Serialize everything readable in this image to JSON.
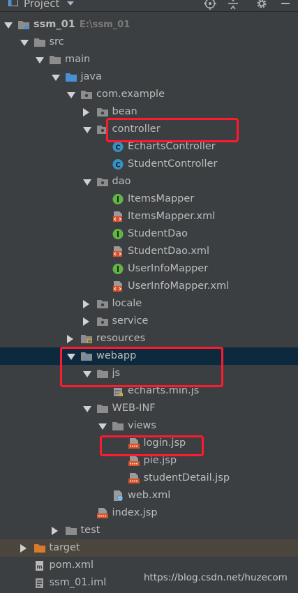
{
  "panel": {
    "title": "Project"
  },
  "tree": [
    {
      "name": "tree-item-ssm-01",
      "label": "ssm_01",
      "path": "E:\\ssm_01",
      "icon": "module-icon",
      "arrow": "down"
    },
    {
      "name": "tree-item-src",
      "label": "src",
      "icon": "folder-icon",
      "arrow": "down"
    },
    {
      "name": "tree-item-main",
      "label": "main",
      "icon": "folder-icon",
      "arrow": "down"
    },
    {
      "name": "tree-item-java",
      "label": "java",
      "icon": "source-folder-icon",
      "arrow": "down"
    },
    {
      "name": "tree-item-com-example",
      "label": "com.example",
      "icon": "package-icon",
      "arrow": "down"
    },
    {
      "name": "tree-item-bean",
      "label": "bean",
      "icon": "package-icon",
      "arrow": "right"
    },
    {
      "name": "tree-item-controller",
      "label": "controller",
      "icon": "package-icon",
      "arrow": "down"
    },
    {
      "name": "tree-item-echarts-controller",
      "label": "EchartsController",
      "icon": "class-icon",
      "arrow": ""
    },
    {
      "name": "tree-item-student-controller",
      "label": "StudentController",
      "icon": "class-icon",
      "arrow": ""
    },
    {
      "name": "tree-item-dao",
      "label": "dao",
      "icon": "package-icon",
      "arrow": "down"
    },
    {
      "name": "tree-item-items-mapper",
      "label": "ItemsMapper",
      "icon": "interface-icon",
      "arrow": ""
    },
    {
      "name": "tree-item-items-mapper-xml",
      "label": "ItemsMapper.xml",
      "icon": "xml-file-icon",
      "arrow": ""
    },
    {
      "name": "tree-item-student-dao",
      "label": "StudentDao",
      "icon": "interface-icon",
      "arrow": ""
    },
    {
      "name": "tree-item-student-dao-xml",
      "label": "StudentDao.xml",
      "icon": "xml-file-icon",
      "arrow": ""
    },
    {
      "name": "tree-item-user-info-mapper",
      "label": "UserInfoMapper",
      "icon": "interface-icon",
      "arrow": ""
    },
    {
      "name": "tree-item-user-info-mapper-xml",
      "label": "UserInfoMapper.xml",
      "icon": "xml-file-icon",
      "arrow": ""
    },
    {
      "name": "tree-item-locale",
      "label": "locale",
      "icon": "package-icon",
      "arrow": "right"
    },
    {
      "name": "tree-item-service",
      "label": "service",
      "icon": "package-icon",
      "arrow": "right"
    },
    {
      "name": "tree-item-resources",
      "label": "resources",
      "icon": "resources-folder-icon",
      "arrow": "right"
    },
    {
      "name": "tree-item-webapp",
      "label": "webapp",
      "icon": "web-folder-icon",
      "arrow": "down"
    },
    {
      "name": "tree-item-js",
      "label": "js",
      "icon": "folder-icon",
      "arrow": "down"
    },
    {
      "name": "tree-item-echarts-min-js",
      "label": "echarts.min.js",
      "icon": "binary-file-icon",
      "arrow": ""
    },
    {
      "name": "tree-item-web-inf",
      "label": "WEB-INF",
      "icon": "folder-icon",
      "arrow": "down"
    },
    {
      "name": "tree-item-views",
      "label": "views",
      "icon": "folder-icon",
      "arrow": "down"
    },
    {
      "name": "tree-item-login-jsp",
      "label": "login.jsp",
      "icon": "jsp-file-icon",
      "arrow": ""
    },
    {
      "name": "tree-item-pie-jsp",
      "label": "pie.jsp",
      "icon": "jsp-file-icon",
      "arrow": ""
    },
    {
      "name": "tree-item-student-detail-jsp",
      "label": "studentDetail.jsp",
      "icon": "jsp-file-icon",
      "arrow": ""
    },
    {
      "name": "tree-item-web-xml",
      "label": "web.xml",
      "icon": "web-xml-icon",
      "arrow": ""
    },
    {
      "name": "tree-item-index-jsp",
      "label": "index.jsp",
      "icon": "jsp-file-icon",
      "arrow": ""
    },
    {
      "name": "tree-item-test",
      "label": "test",
      "icon": "folder-icon",
      "arrow": "right"
    },
    {
      "name": "tree-item-target",
      "label": "target",
      "icon": "excluded-folder-icon",
      "arrow": "right"
    },
    {
      "name": "tree-item-pom-xml",
      "label": "pom.xml",
      "icon": "maven-file-icon",
      "arrow": ""
    },
    {
      "name": "tree-item-ssm-01-iml",
      "label": "ssm_01.iml",
      "icon": "iml-file-icon",
      "arrow": ""
    }
  ],
  "watermark": "https://blog.csdn.net/huzecom",
  "colors": {
    "background": "#3c3f41",
    "selection": "#0d293e",
    "excluded_row": "#4a463d",
    "highlight_box": "#ff1a2e",
    "folder": "#8c8c8c",
    "source_folder": "#4a8fd6",
    "class": "#3592c4",
    "interface": "#62b543",
    "excluded_folder": "#d87b2a"
  }
}
